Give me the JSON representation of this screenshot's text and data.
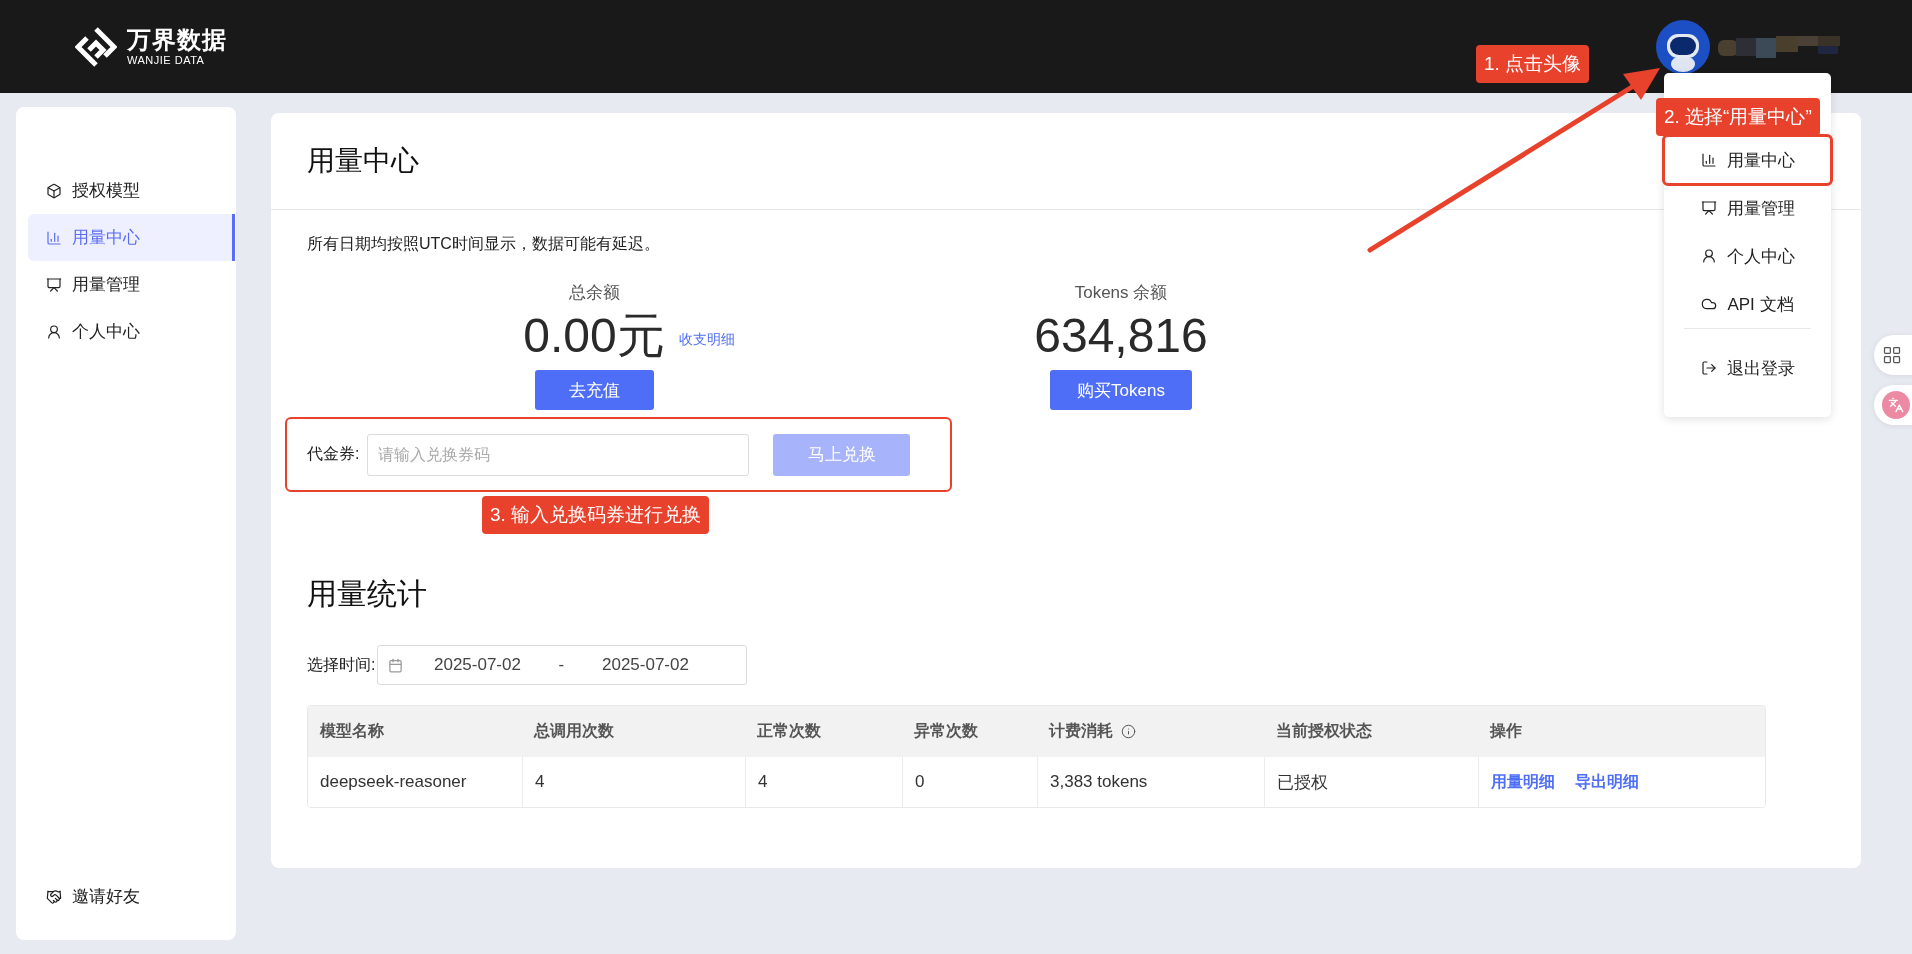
{
  "header": {
    "logo_title": "万界数据",
    "logo_subtitle": "WANJIE DATA"
  },
  "user_menu": {
    "items": [
      {
        "kind": "usage",
        "label": "用量中心",
        "outlined": true
      },
      {
        "kind": "manage",
        "label": "用量管理",
        "outlined": false
      },
      {
        "kind": "profile",
        "label": "个人中心",
        "outlined": false
      },
      {
        "kind": "api",
        "label": "API 文档",
        "outlined": false
      },
      {
        "kind": "logout",
        "label": "退出登录",
        "outlined": false
      }
    ]
  },
  "sidebar": {
    "items": [
      {
        "kind": "model",
        "label": "授权模型",
        "selected": false
      },
      {
        "kind": "usage",
        "label": "用量中心",
        "selected": true
      },
      {
        "kind": "manage",
        "label": "用量管理",
        "selected": false
      },
      {
        "kind": "profile",
        "label": "个人中心",
        "selected": false
      }
    ],
    "footer_item": "邀请好友"
  },
  "main": {
    "title": "用量中心",
    "notice": "所有日期均按照UTC时间显示，数据可能有延迟。",
    "balance": {
      "label": "总余额",
      "amount": "0.00元",
      "link": "收支明细",
      "button": "去充值"
    },
    "tokens": {
      "label": "Tokens 余额",
      "amount": "634,816",
      "button": "购买Tokens"
    },
    "voucher": {
      "label": "代金券:",
      "placeholder": "请输入兑换券码",
      "button": "马上兑换",
      "outlined": true
    },
    "stats_title": "用量统计",
    "date_range": {
      "label": "选择时间:",
      "start": "2025-07-02",
      "separator": "-",
      "end": "2025-07-02"
    },
    "table": {
      "columns": [
        {
          "label": "模型名称",
          "info": false
        },
        {
          "label": "总调用次数",
          "info": false
        },
        {
          "label": "正常次数",
          "info": false
        },
        {
          "label": "异常次数",
          "info": false
        },
        {
          "label": "计费消耗",
          "info": true
        },
        {
          "label": "当前授权状态",
          "info": false
        },
        {
          "label": "操作",
          "info": false
        }
      ],
      "rows": [
        {
          "cells": [
            "deepseek-reasoner",
            "4",
            "4",
            "0",
            "3,383 tokens",
            "已授权"
          ],
          "actions": [
            "用量明细",
            "导出明细"
          ]
        }
      ]
    }
  },
  "annotations": {
    "avatar_hint": "1. 点击头像",
    "menu_hint": "2. 选择“用量中心”",
    "voucher_hint": "3. 输入兑换码券进行兑换"
  }
}
